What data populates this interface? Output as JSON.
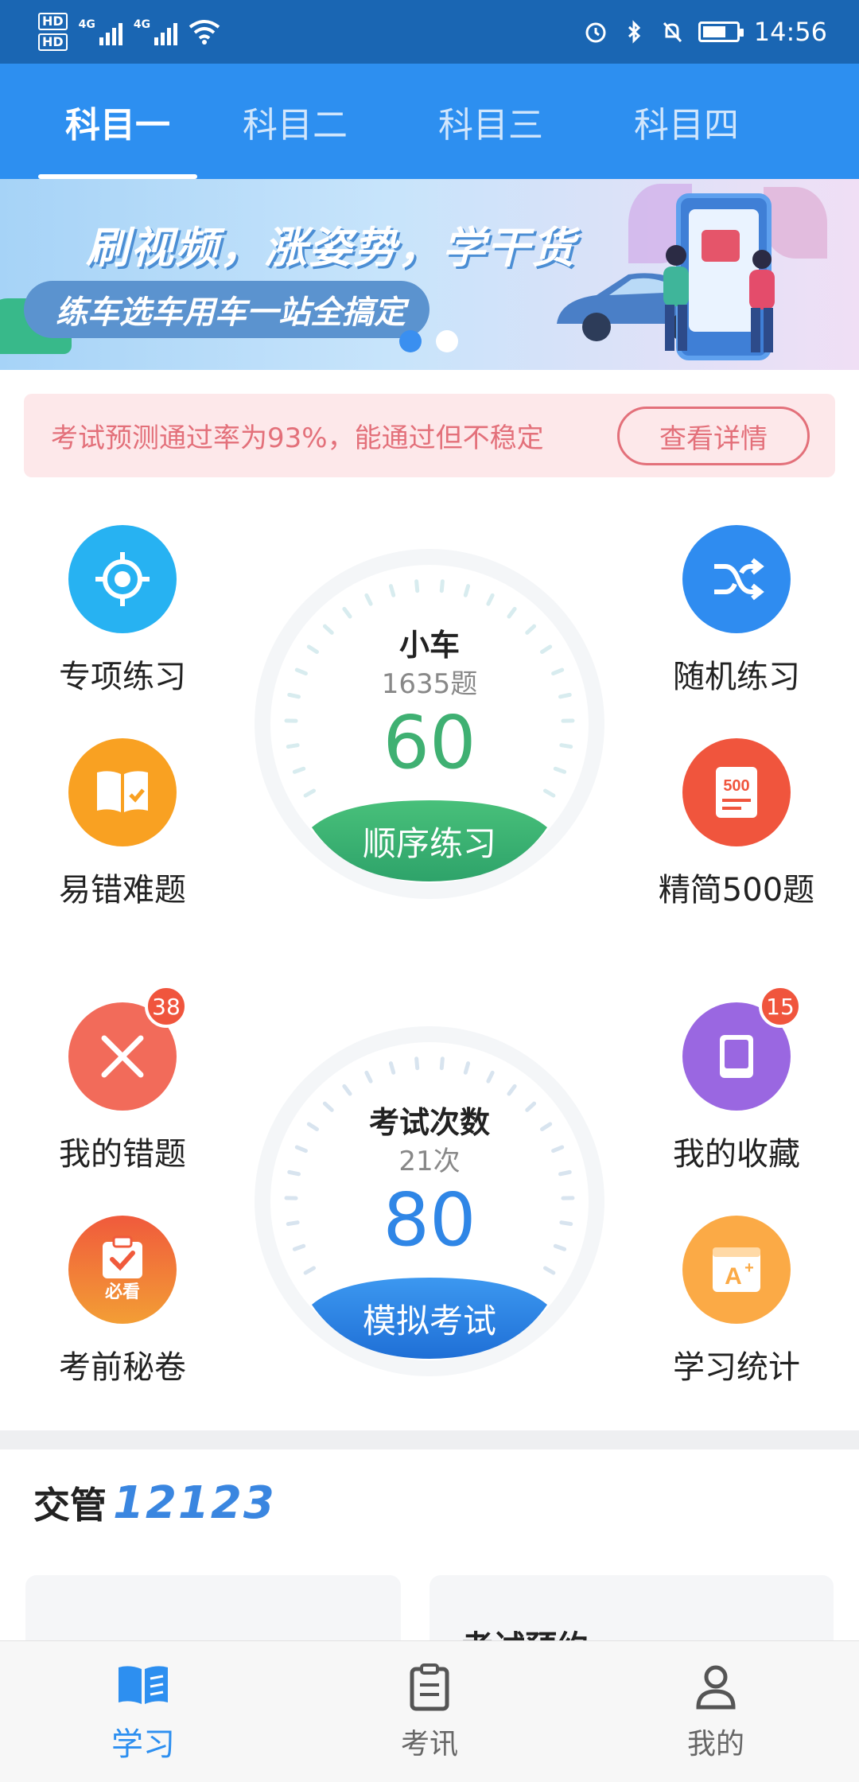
{
  "status_bar": {
    "time": "14:56",
    "sim1": "HD",
    "sim2": "HD",
    "network1": "4G",
    "network2": "4G",
    "battery_percent": 0.7
  },
  "tabs": [
    {
      "label": "科目一",
      "active": true
    },
    {
      "label": "科目二",
      "active": false
    },
    {
      "label": "科目三",
      "active": false
    },
    {
      "label": "科目四",
      "active": false
    }
  ],
  "banner": {
    "title": "刷视频，涨姿势，学干货",
    "subtitle": "练车选车用车一站全搞定",
    "dots": 2,
    "active_dot": 0
  },
  "notice": {
    "text": "考试预测通过率为93%，能通过但不稳定",
    "button": "查看详情"
  },
  "features_top": {
    "left": [
      {
        "label": "专项练习",
        "icon": "target-icon",
        "color": "#27b2f2"
      },
      {
        "label": "易错难题",
        "icon": "book-check-icon",
        "color": "#f9a122"
      }
    ],
    "right": [
      {
        "label": "随机练习",
        "icon": "shuffle-icon",
        "color": "#2f8cf0"
      },
      {
        "label": "精简500题",
        "icon": "doc-500-icon",
        "color": "#f0553d"
      }
    ]
  },
  "dial_practice": {
    "title": "小车",
    "subtitle": "1635题",
    "value": "60",
    "button": "顺序练习",
    "color": "#3fb072"
  },
  "features_bottom": {
    "left": [
      {
        "label": "我的错题",
        "icon": "close-icon",
        "color": "#f26b5a",
        "badge": "38"
      },
      {
        "label": "考前秘卷",
        "icon": "clipboard-check-icon",
        "color": "#f05a3c",
        "tag": "必看"
      }
    ],
    "right": [
      {
        "label": "我的收藏",
        "icon": "bookmark-book-icon",
        "color": "#9a67e1",
        "badge": "15"
      },
      {
        "label": "学习统计",
        "icon": "grade-card-icon",
        "color": "#fbaa46"
      }
    ]
  },
  "dial_exam": {
    "title": "考试次数",
    "subtitle": "21次",
    "value": "80",
    "button": "模拟考试",
    "color": "#2f86e6"
  },
  "section": {
    "title_prefix": "交管",
    "title_number": "12123"
  },
  "cards": [
    {
      "title": ""
    },
    {
      "title": "考试预约"
    }
  ],
  "bottom_nav": [
    {
      "label": "学习",
      "icon": "book-open-icon",
      "active": true
    },
    {
      "label": "考讯",
      "icon": "clipboard-list-icon",
      "active": false
    },
    {
      "label": "我的",
      "icon": "user-icon",
      "active": false
    }
  ]
}
